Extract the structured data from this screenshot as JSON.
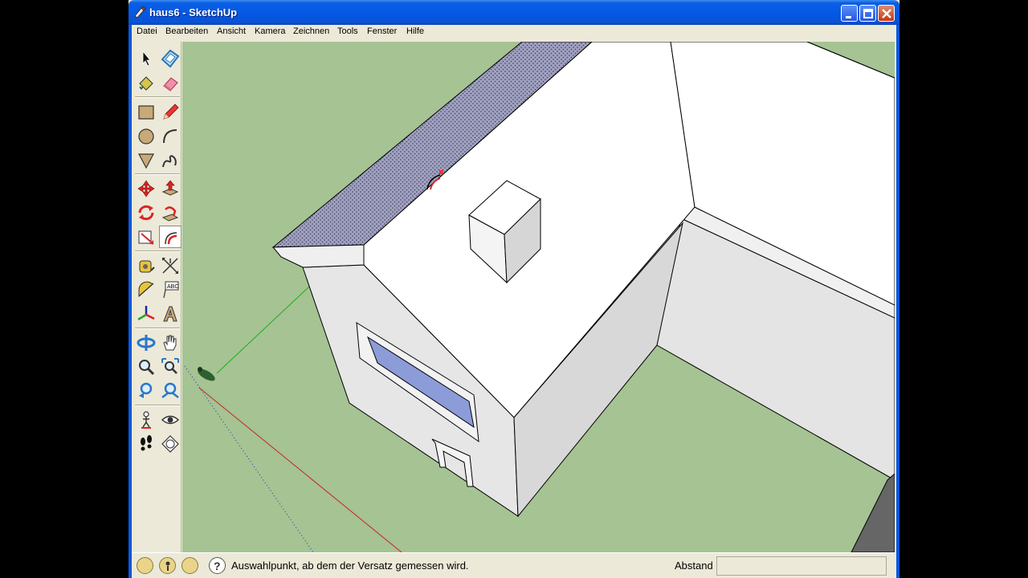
{
  "window": {
    "title": "haus6 - SketchUp"
  },
  "menu": [
    "Datei",
    "Bearbeiten",
    "Ansicht",
    "Kamera",
    "Zeichnen",
    "Tools",
    "Fenster",
    "Hilfe"
  ],
  "toolbar": {
    "tools": [
      "select-tool-icon",
      "component-icon",
      "paint-bucket-icon",
      "eraser-icon",
      "rectangle-icon",
      "pencil-icon",
      "circle-icon",
      "arc-icon",
      "polygon-icon",
      "freehand-icon",
      "move-icon",
      "push-pull-icon",
      "rotate-icon",
      "follow-me-icon",
      "scale-icon",
      "offset-icon",
      "tape-measure-icon",
      "dimension-icon",
      "protractor-icon",
      "text-icon",
      "axes-icon",
      "3d-text-icon",
      "orbit-icon",
      "pan-icon",
      "zoom-icon",
      "zoom-window-icon",
      "previous-view-icon",
      "zoom-extents-icon",
      "position-camera-icon",
      "look-around-icon",
      "walk-icon",
      "section-plane-icon"
    ],
    "active_tool": "offset-icon"
  },
  "status": {
    "message": "Auswahlpunkt, ab dem der Versatz gemessen wird.",
    "measure_label": "Abstand",
    "measure_value": ""
  },
  "colors": {
    "ground": "#A5C393",
    "roof_gable": "#9696B4",
    "wall": "#E6E6E6",
    "title_bar": "#0457E3"
  }
}
